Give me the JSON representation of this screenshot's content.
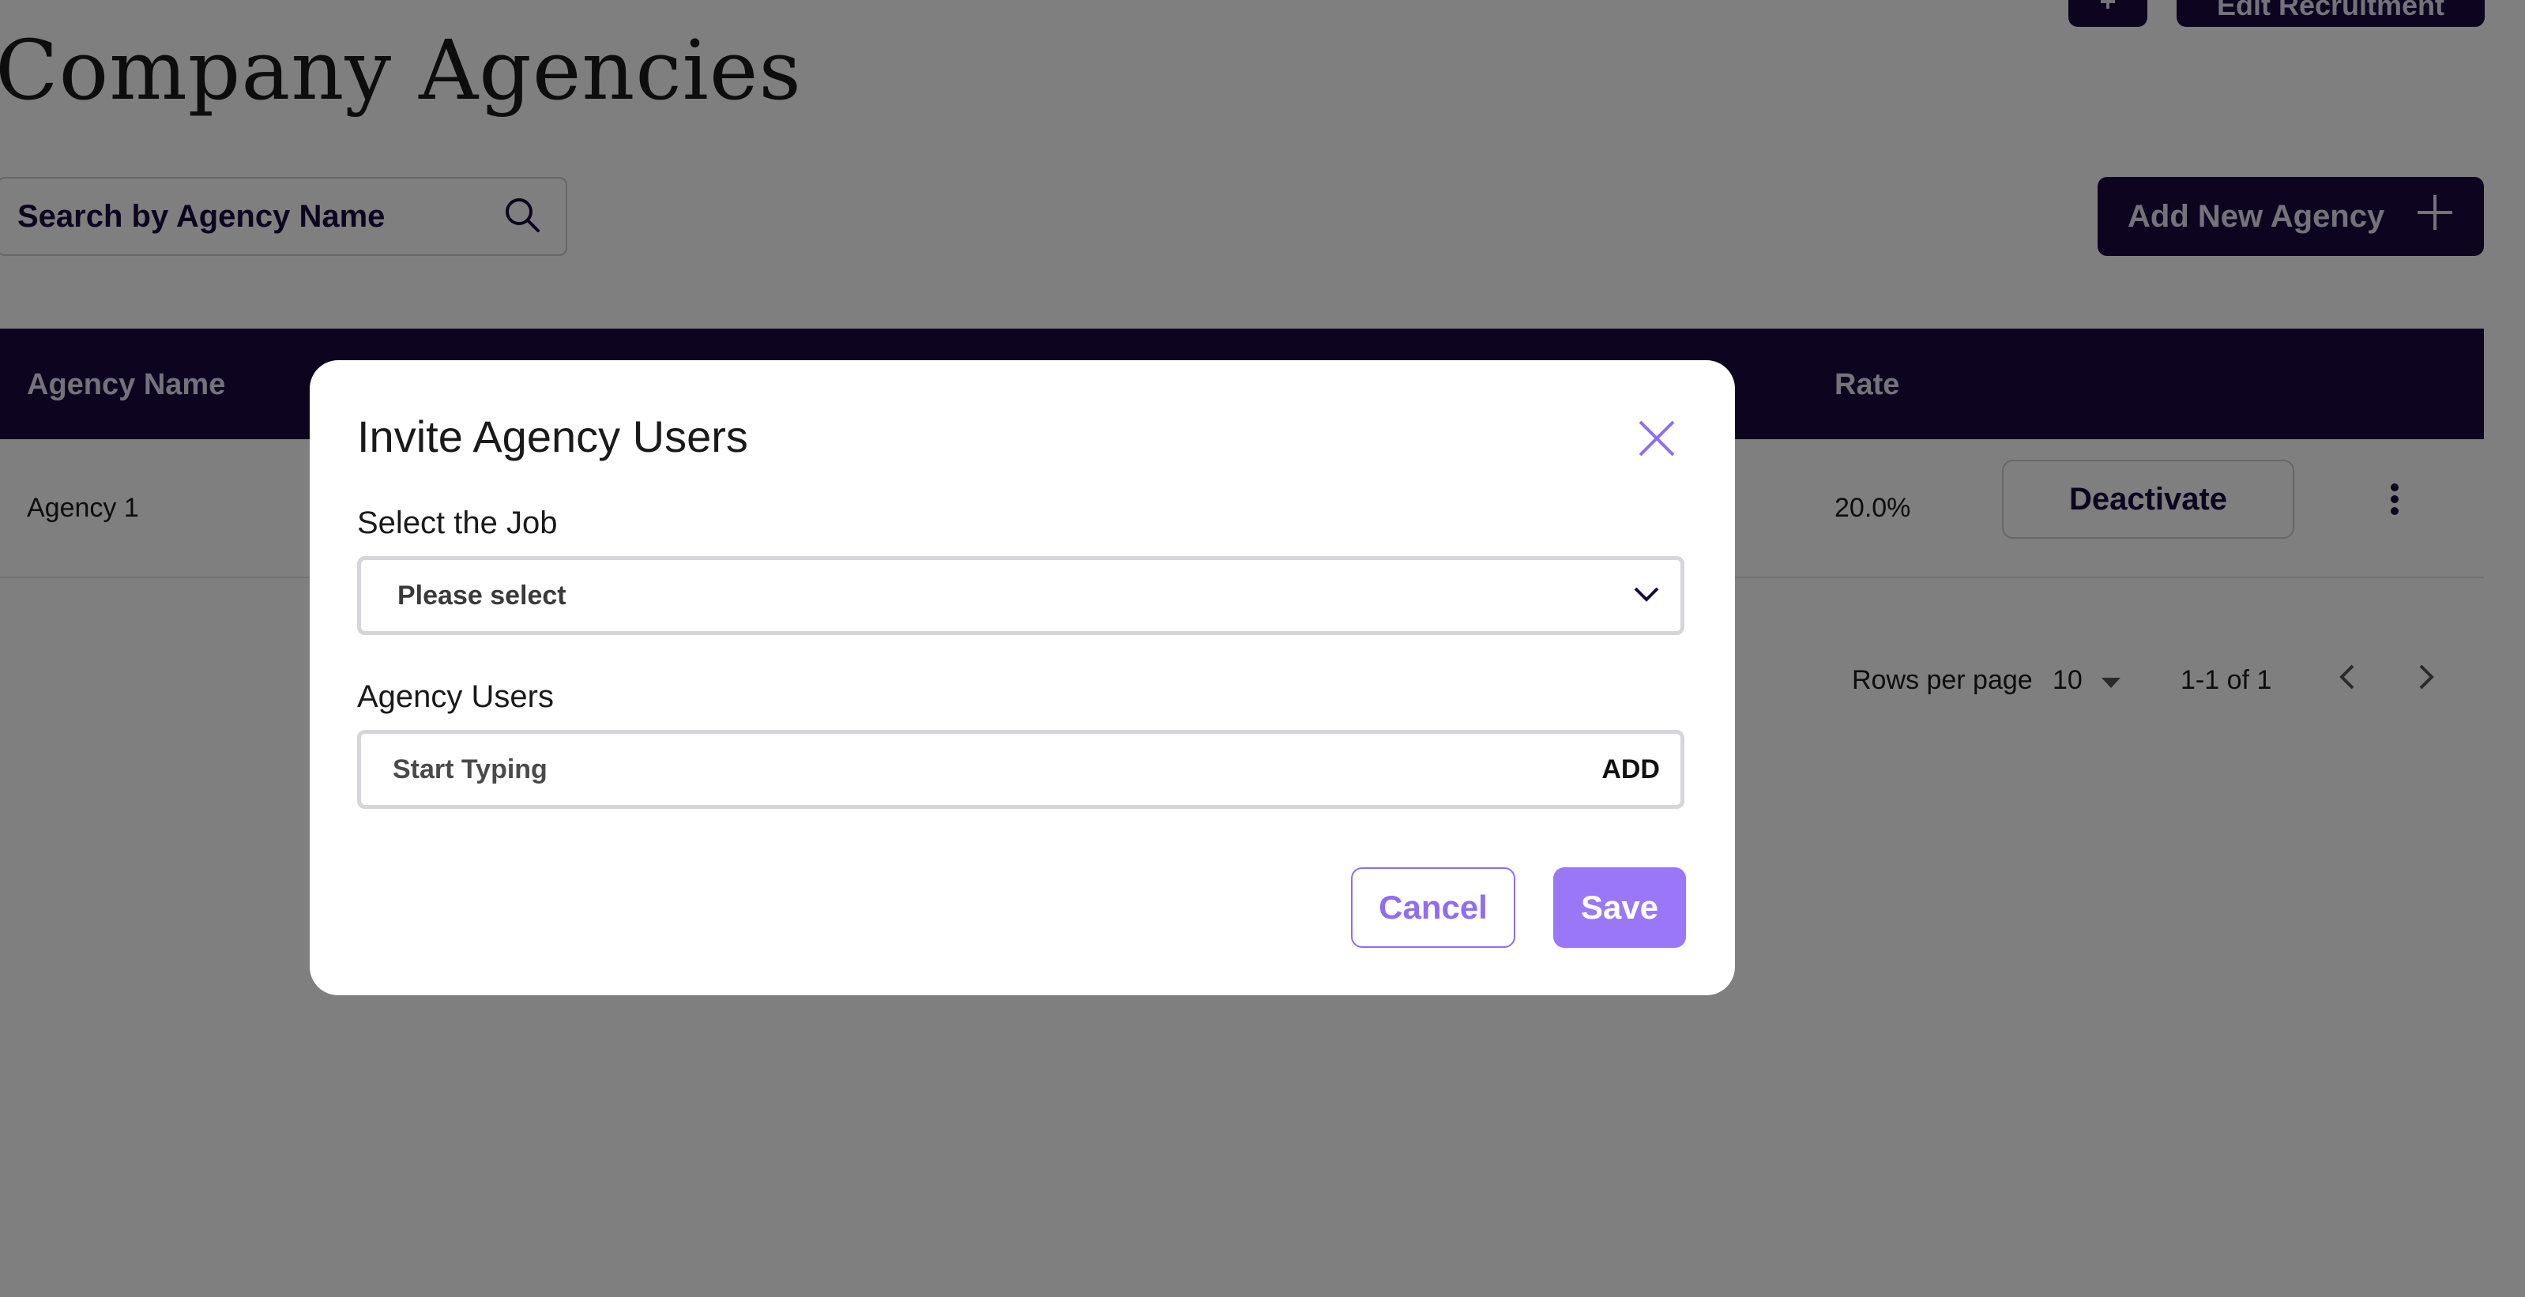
{
  "page": {
    "title": "Company Agencies",
    "top_buttons": {
      "icon_button_glyph": "+",
      "wide_button_label": "Edit Recruitment"
    },
    "search": {
      "placeholder": "Search by Agency Name",
      "icon": "search-icon"
    },
    "add_agency": {
      "label": "Add New Agency",
      "icon": "plus-icon"
    }
  },
  "table": {
    "columns": {
      "agency_name": "Agency Name",
      "rate": "Rate"
    },
    "rows": [
      {
        "agency_name": "Agency 1",
        "rate": "20.0%",
        "action_label": "Deactivate",
        "menu_icon": "kebab-menu-icon"
      }
    ],
    "pagination": {
      "rows_per_page_label": "Rows per page",
      "rows_per_page_value": "10",
      "range_text": "1-1 of 1"
    }
  },
  "modal": {
    "title": "Invite Agency Users",
    "job_label": "Select the Job",
    "job_value": "Please select",
    "users_label": "Agency Users",
    "users_placeholder": "Start Typing",
    "add_label": "ADD",
    "cancel_label": "Cancel",
    "save_label": "Save"
  },
  "colors": {
    "brand_dark": "#1b0a3f",
    "accent_purple": "#9a77f7",
    "overlay": "rgba(0,0,0,0.5)"
  }
}
